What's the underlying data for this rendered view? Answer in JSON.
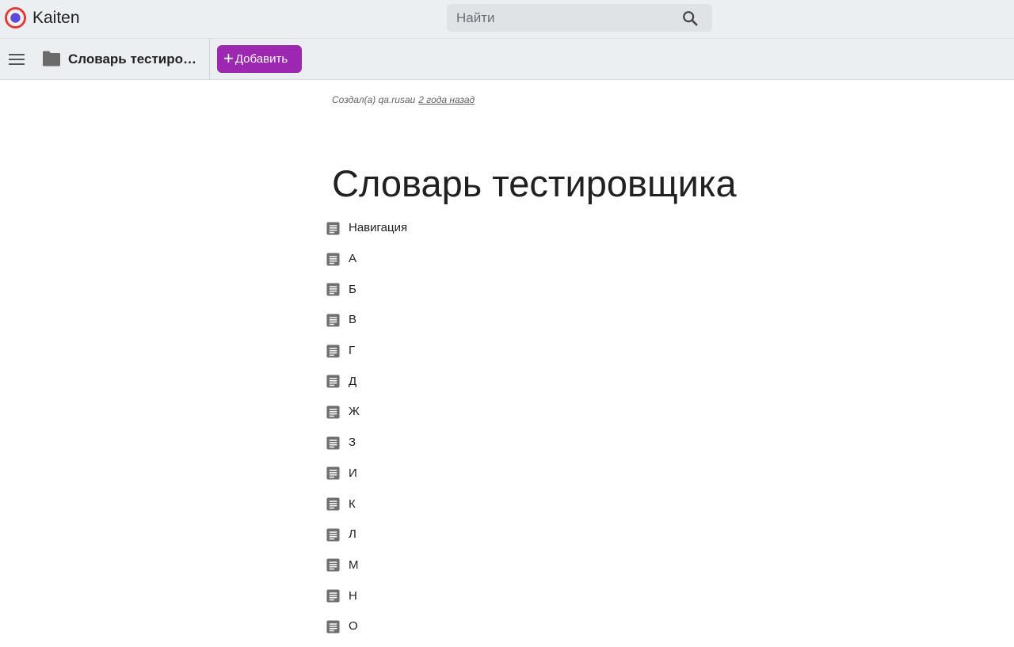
{
  "app": {
    "name": "Kaiten",
    "logo_icon": "kaiten-logo-icon",
    "colors": {
      "accent": "#9c27b0",
      "logo_outer": "#e53935",
      "logo_inner": "#5c4bd8"
    }
  },
  "search": {
    "placeholder": "Найти",
    "icon": "search-icon"
  },
  "toolbar": {
    "menu_icon": "hamburger-menu-icon",
    "folder_icon": "folder-icon",
    "space_title": "Словарь тестиро…",
    "add_label": "Добавить",
    "add_icon": "plus-icon"
  },
  "document": {
    "created_by_label": "Создал(а) qa.rusau",
    "created_time": "2 года назад",
    "title": "Словарь тестировщика",
    "items": [
      {
        "label": "Навигация",
        "icon": "document-icon"
      },
      {
        "label": "А",
        "icon": "document-icon"
      },
      {
        "label": "Б",
        "icon": "document-icon"
      },
      {
        "label": "В",
        "icon": "document-icon"
      },
      {
        "label": "Г",
        "icon": "document-icon"
      },
      {
        "label": "Д",
        "icon": "document-icon"
      },
      {
        "label": "Ж",
        "icon": "document-icon"
      },
      {
        "label": "З",
        "icon": "document-icon"
      },
      {
        "label": "И",
        "icon": "document-icon"
      },
      {
        "label": "К",
        "icon": "document-icon"
      },
      {
        "label": "Л",
        "icon": "document-icon"
      },
      {
        "label": "М",
        "icon": "document-icon"
      },
      {
        "label": "Н",
        "icon": "document-icon"
      },
      {
        "label": "О",
        "icon": "document-icon"
      }
    ]
  }
}
